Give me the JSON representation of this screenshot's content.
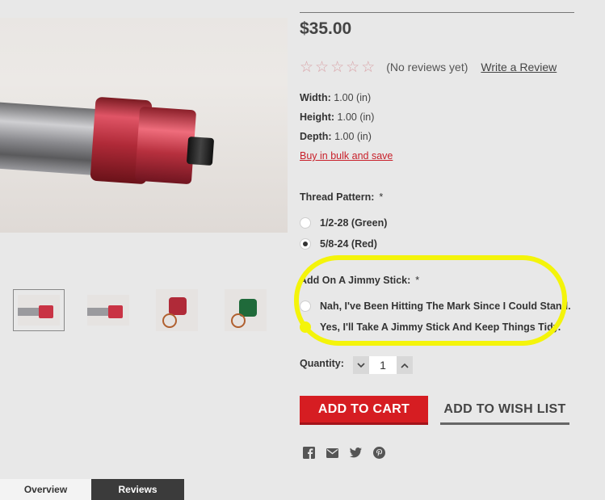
{
  "product": {
    "price": "$35.00",
    "rating": {
      "stars_filled": 0,
      "stars_total": 5,
      "no_reviews_text": "(No reviews yet)",
      "write_review_label": "Write a Review"
    },
    "specs": [
      {
        "label": "Width:",
        "value": "1.00 (in)"
      },
      {
        "label": "Height:",
        "value": "1.00 (in)"
      },
      {
        "label": "Depth:",
        "value": "1.00 (in)"
      }
    ],
    "bulk_link": "Buy in bulk and save"
  },
  "options": {
    "thread_pattern": {
      "label": "Thread Pattern:",
      "required_mark": "*",
      "choices": [
        {
          "label": "1/2-28 (Green)",
          "checked": false
        },
        {
          "label": "5/8-24 (Red)",
          "checked": true
        }
      ]
    },
    "jimmy_stick": {
      "label": "Add On A Jimmy Stick:",
      "required_mark": "*",
      "choices": [
        {
          "label": "Nah, I've Been Hitting The Mark Since I Could Stand.",
          "checked": false
        },
        {
          "label": "Yes, I'll Take A Jimmy Stick And Keep Things Tidy.",
          "checked": false
        }
      ]
    }
  },
  "quantity": {
    "label": "Quantity:",
    "value": "1",
    "decrement_icon": "chevron-down-icon",
    "increment_icon": "chevron-up-icon"
  },
  "actions": {
    "add_to_cart": "ADD TO CART",
    "add_to_wish_list": "ADD TO WISH LIST"
  },
  "share_icons": [
    "facebook-icon",
    "email-icon",
    "twitter-icon",
    "pinterest-icon"
  ],
  "tabs": [
    {
      "label": "Overview",
      "active": false
    },
    {
      "label": "Reviews",
      "active": true
    }
  ],
  "colors": {
    "accent_red": "#d61d22",
    "highlight_yellow": "#f4f40a",
    "tab_dark": "#3b3b3b"
  }
}
